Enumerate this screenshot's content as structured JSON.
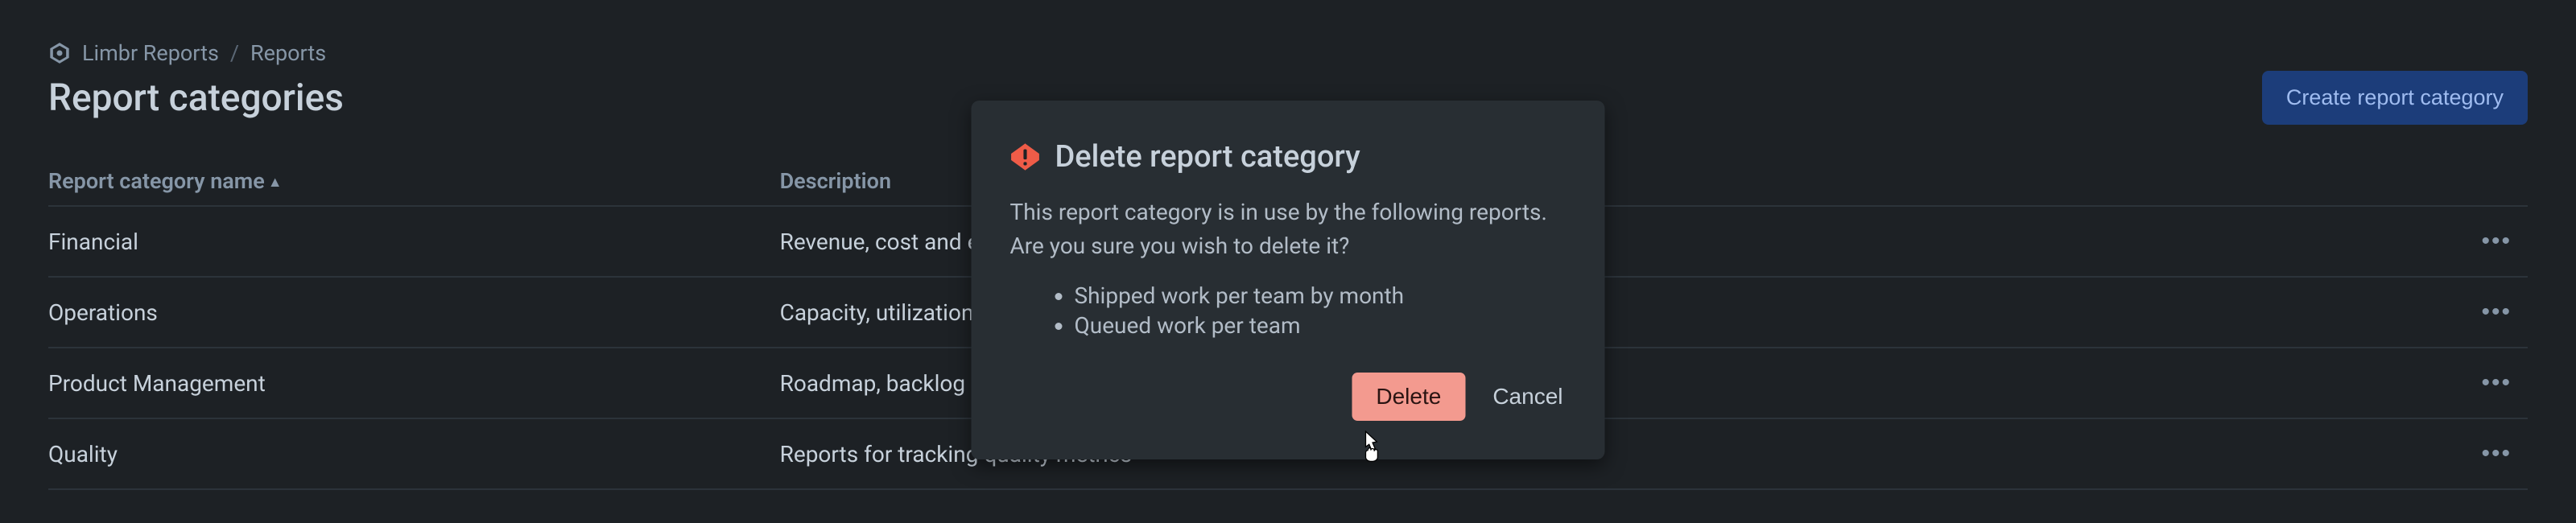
{
  "breadcrumb": {
    "app": "Limbr Reports",
    "section": "Reports"
  },
  "page_title": "Report categories",
  "header": {
    "create_button": "Create report category"
  },
  "table": {
    "columns": {
      "name": "Report category name",
      "description": "Description"
    },
    "rows": [
      {
        "name": "Financial",
        "description": "Revenue, cost and earnings reports"
      },
      {
        "name": "Operations",
        "description": "Capacity, utilization and efficiency reports"
      },
      {
        "name": "Product Management",
        "description": "Roadmap, backlog and delivery reports"
      },
      {
        "name": "Quality",
        "description": "Reports for tracking quality metrics"
      }
    ]
  },
  "modal": {
    "title": "Delete report category",
    "message": "This report category is in use by the following reports. Are you sure you wish to delete it?",
    "reports": [
      "Shipped work per team by month",
      "Queued work per team"
    ],
    "delete_label": "Delete",
    "cancel_label": "Cancel"
  },
  "colors": {
    "accent_blue": "#1c3d7a",
    "danger": "#f39a8f",
    "bg": "#1d2125",
    "panel": "#282e33",
    "text": "#c7d1db",
    "muted": "#8696a7"
  }
}
